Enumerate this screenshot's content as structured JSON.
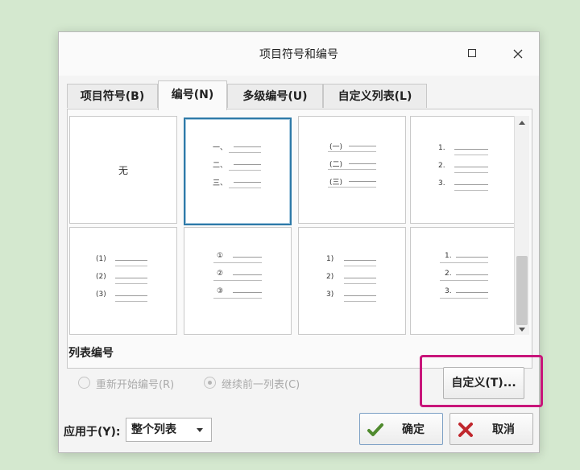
{
  "dialog": {
    "title": "项目符号和编号"
  },
  "tabs": [
    {
      "label": "项目符号(B)",
      "active": false
    },
    {
      "label": "编号(N)",
      "active": true
    },
    {
      "label": "多级编号(U)",
      "active": false
    },
    {
      "label": "自定义列表(L)",
      "active": false
    }
  ],
  "gallery": {
    "none_label": "无",
    "styles": [
      {
        "markers": [
          "一、",
          "二、",
          "三、"
        ],
        "selected": true
      },
      {
        "markers": [
          "(一)",
          "(二)",
          "(三)"
        ],
        "selected": false
      },
      {
        "markers": [
          "1.",
          "2.",
          "3."
        ],
        "selected": false
      },
      {
        "markers": [
          "(1)",
          "(2)",
          "(3)"
        ],
        "selected": false
      },
      {
        "markers": [
          "①",
          "②",
          "③"
        ],
        "selected": false
      },
      {
        "markers": [
          "1)",
          "2)",
          "3)"
        ],
        "selected": false
      },
      {
        "markers": [
          "1.",
          "2.",
          "3."
        ],
        "selected": false
      }
    ]
  },
  "list_numbering": {
    "section_label": "列表编号",
    "restart_label": "重新开始编号(R)",
    "continue_label": "继续前一列表(C)",
    "custom_button": "自定义(T)..."
  },
  "footer": {
    "apply_label": "应用于(Y):",
    "apply_value": "整个列表",
    "ok_label": "确定",
    "cancel_label": "取消"
  },
  "colors": {
    "highlight": "#c8157a",
    "selection": "#2e7aa8",
    "background": "#d4e8cf"
  }
}
